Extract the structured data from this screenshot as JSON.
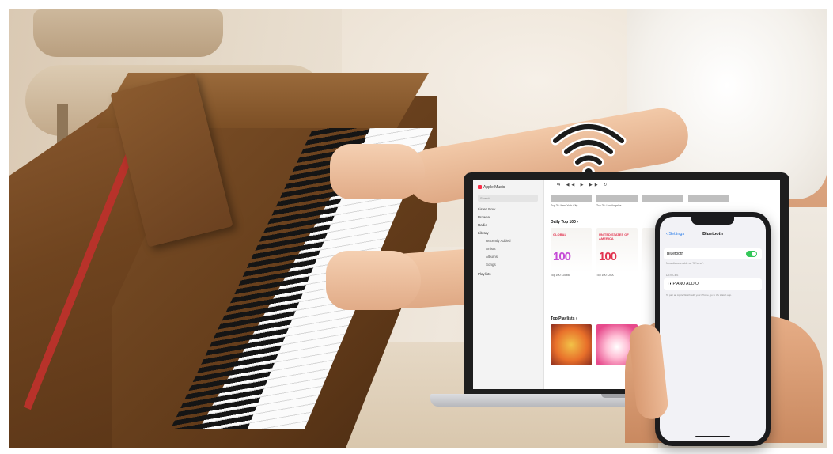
{
  "scene": {
    "description_icon": "wifi-icon",
    "colors": {
      "wood": "#7e5128",
      "felt": "#b8322a",
      "music_accent": "#fa2d48",
      "ios_toggle": "#34c759",
      "ios_link": "#1a73e8"
    }
  },
  "laptop": {
    "app_name": "Apple Music",
    "search_placeholder": "Search",
    "sidebar": {
      "items": [
        "Listen Now",
        "Browse",
        "Radio",
        "Library"
      ],
      "library_items": [
        "Recently Added",
        "Artists",
        "Albums",
        "Songs"
      ],
      "playlists": "Playlists"
    },
    "toolbar": "⇆ ◀◀ ▶ ▶▶ ↻",
    "top_captions": [
      "Top 25: New York City",
      "Top 25: Los Angeles"
    ],
    "section_daily": "Daily Top 100 ›",
    "cards": [
      {
        "top": "GLOBAL",
        "num": "100",
        "caption": "Top 100: Global"
      },
      {
        "top": "UNITED STATES OF AMERICA",
        "num": "100",
        "caption": "Top 100: USA"
      }
    ],
    "section_playlists": "Top Playlists ›"
  },
  "phone": {
    "back_label": "‹ Settings",
    "title": "Bluetooth",
    "toggle_label": "Bluetooth",
    "discoverable_text": "Now discoverable as \"iPhone\".",
    "section_label": "DEVICES",
    "device_name": "PIANO AUDIO",
    "pair_hint": "To pair an Apple Watch with your iPhone, go to the Watch app."
  }
}
